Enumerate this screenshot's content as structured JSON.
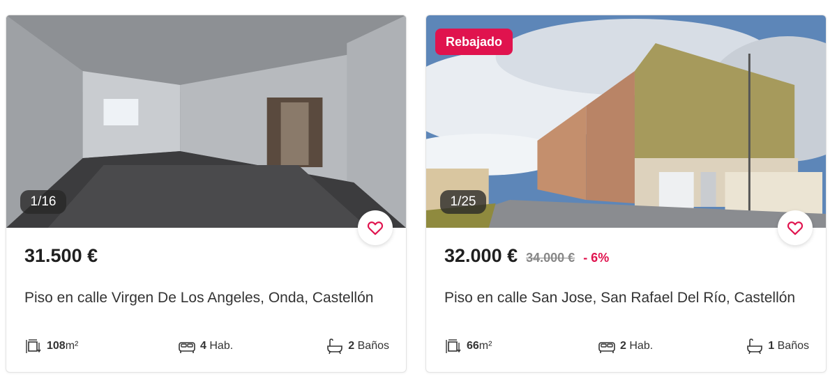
{
  "listings": [
    {
      "photo_counter": "1/16",
      "badge": "",
      "price": "31.500 €",
      "old_price": "",
      "discount": "",
      "title": "Piso en calle Virgen De Los Angeles, Onda, Castellón",
      "area_value": "108",
      "area_unit": "m²",
      "rooms_value": "4",
      "rooms_label": "Hab.",
      "baths_value": "2",
      "baths_label": "Baños"
    },
    {
      "photo_counter": "1/25",
      "badge": "Rebajado",
      "price": "32.000 €",
      "old_price": "34.000 €",
      "discount": "- 6%",
      "title": "Piso en calle San Jose, San Rafael Del Río, Castellón",
      "area_value": "66",
      "area_unit": "m²",
      "rooms_value": "2",
      "rooms_label": "Hab.",
      "baths_value": "1",
      "baths_label": "Baños"
    }
  ],
  "colors": {
    "accent": "#e0134e",
    "text": "#222222",
    "muted": "#888888"
  },
  "icons": {
    "favorite": "heart-icon",
    "area": "area-icon",
    "rooms": "bed-icon",
    "baths": "bathtub-icon"
  }
}
